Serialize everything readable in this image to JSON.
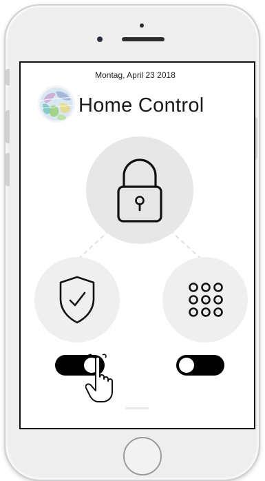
{
  "screen": {
    "date": "Montag, April 23 2018",
    "title": "Home Control"
  },
  "controls": {
    "lock": {
      "icon": "padlock-icon"
    },
    "security": {
      "icon": "shield-check-icon",
      "toggle_on": true
    },
    "keypad": {
      "icon": "keypad-icon",
      "toggle_on": false
    }
  },
  "colors": {
    "toggle_track": "#000000",
    "circle_bg": "#e7e7e7",
    "connector": "#d6d6d6"
  }
}
